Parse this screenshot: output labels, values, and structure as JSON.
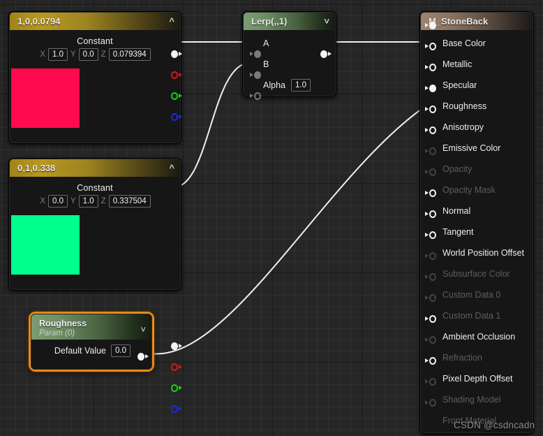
{
  "editor": {
    "name": "material-graph-editor"
  },
  "watermark": {
    "text": "CSDN @csdncadn"
  },
  "nodes": {
    "const_a": {
      "title": "1,0,0.0794",
      "collapse_icon": "chevron-up-icon",
      "label": "Constant",
      "axes": [
        {
          "name": "X",
          "value": "1.0"
        },
        {
          "name": "Y",
          "value": "0.0"
        },
        {
          "name": "Z",
          "value": "0.079394"
        }
      ],
      "swatch_color": "#ff0a4e",
      "output_pins": [
        {
          "name": "rgb",
          "color": "white",
          "filled": true
        },
        {
          "name": "r",
          "color": "red",
          "filled": false
        },
        {
          "name": "g",
          "color": "green",
          "filled": false
        },
        {
          "name": "b",
          "color": "blue",
          "filled": false
        }
      ]
    },
    "const_b": {
      "title": "0,1,0.338",
      "collapse_icon": "chevron-up-icon",
      "label": "Constant",
      "axes": [
        {
          "name": "X",
          "value": "0.0"
        },
        {
          "name": "Y",
          "value": "1.0"
        },
        {
          "name": "Z",
          "value": "0.337504"
        }
      ],
      "swatch_color": "#00ff8c",
      "output_pins": [
        {
          "name": "rgb",
          "color": "white",
          "filled": true
        },
        {
          "name": "r",
          "color": "red",
          "filled": false
        },
        {
          "name": "g",
          "color": "green",
          "filled": false
        },
        {
          "name": "b",
          "color": "blue",
          "filled": false
        }
      ]
    },
    "lerp": {
      "title": "Lerp(,,1)",
      "collapse_icon": "chevron-down-icon",
      "inputs": [
        {
          "label": "A",
          "filled": true,
          "value": null
        },
        {
          "label": "B",
          "filled": true,
          "value": null
        },
        {
          "label": "Alpha",
          "filled": false,
          "value": "1.0"
        }
      ],
      "output": {
        "name": "result",
        "filled": true
      }
    },
    "param_roughness": {
      "title": "Roughness",
      "subtitle": "Param (0)",
      "collapse_icon": "chevron-down-icon",
      "selected": true,
      "row_label": "Default Value",
      "row_value": "0.0",
      "output": {
        "name": "param-out",
        "filled": true
      }
    },
    "material": {
      "title": "M_StoneBack",
      "pins": [
        {
          "label": "Base Color",
          "filled": true,
          "enabled": true
        },
        {
          "label": "Metallic",
          "filled": false,
          "enabled": true
        },
        {
          "label": "Specular",
          "filled": false,
          "enabled": true
        },
        {
          "label": "Roughness",
          "filled": true,
          "enabled": true
        },
        {
          "label": "Anisotropy",
          "filled": false,
          "enabled": true
        },
        {
          "label": "Emissive Color",
          "filled": false,
          "enabled": true
        },
        {
          "label": "Opacity",
          "filled": false,
          "enabled": false
        },
        {
          "label": "Opacity Mask",
          "filled": false,
          "enabled": false
        },
        {
          "label": "Normal",
          "filled": false,
          "enabled": true
        },
        {
          "label": "Tangent",
          "filled": false,
          "enabled": true
        },
        {
          "label": "World Position Offset",
          "filled": false,
          "enabled": true
        },
        {
          "label": "Subsurface Color",
          "filled": false,
          "enabled": false
        },
        {
          "label": "Custom Data 0",
          "filled": false,
          "enabled": false
        },
        {
          "label": "Custom Data 1",
          "filled": false,
          "enabled": false
        },
        {
          "label": "Ambient Occlusion",
          "filled": false,
          "enabled": true
        },
        {
          "label": "Refraction",
          "filled": false,
          "enabled": false
        },
        {
          "label": "Pixel Depth Offset",
          "filled": false,
          "enabled": true
        },
        {
          "label": "Shading Model",
          "filled": false,
          "enabled": false
        },
        {
          "label": "Front Material",
          "filled": false,
          "enabled": false
        }
      ]
    }
  },
  "connections": [
    {
      "from": "const_a.rgb",
      "to": "lerp.A"
    },
    {
      "from": "const_b.rgb",
      "to": "lerp.B"
    },
    {
      "from": "lerp.result",
      "to": "material.Base Color"
    },
    {
      "from": "param_roughness.out",
      "to": "material.Roughness"
    }
  ],
  "colors": {
    "wire": "#f0f0f0",
    "selection": "#e88a16",
    "canvas_bg": "#262626"
  }
}
